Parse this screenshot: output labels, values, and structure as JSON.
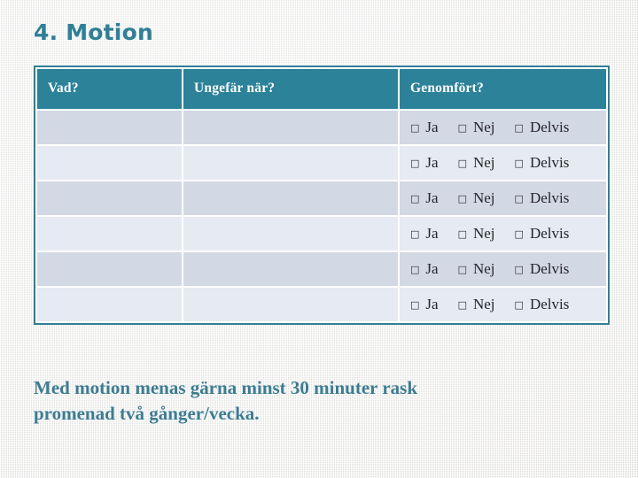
{
  "slide": {
    "title": "4. Motion",
    "footnote_lines": [
      "Med motion menas gärna minst 30 minuter rask",
      "promenad  två gånger/vecka."
    ],
    "footnote": "Med motion menas gärna minst 30 minuter rask promenad  två gånger/vecka."
  },
  "table": {
    "headers": [
      "Vad?",
      "Ungefär när?",
      "Genomfört?"
    ],
    "checkbox_glyph": "□",
    "choice_labels": [
      "Ja",
      "Nej",
      "Delvis"
    ],
    "rows": [
      {
        "what": "",
        "when": "",
        "choices": [
          "Ja",
          "Nej",
          "Delvis"
        ]
      },
      {
        "what": "",
        "when": "",
        "choices": [
          "Ja",
          "Nej",
          "Delvis"
        ]
      },
      {
        "what": "",
        "when": "",
        "choices": [
          "Ja",
          "Nej",
          "Delvis"
        ]
      },
      {
        "what": "",
        "when": "",
        "choices": [
          "Ja",
          "Nej",
          "Delvis"
        ]
      },
      {
        "what": "",
        "when": "",
        "choices": [
          "Ja",
          "Nej",
          "Delvis"
        ]
      },
      {
        "what": "",
        "when": "",
        "choices": [
          "Ja",
          "Nej",
          "Delvis"
        ]
      }
    ]
  },
  "colors": {
    "accent_teal": "#2b8299",
    "title_teal": "#2f7f96",
    "footnote_teal": "#3c7c92",
    "row_dark": "#d2d8e4",
    "row_light": "#e6eaf2",
    "background": "#f0efed",
    "header_text": "#ffffff",
    "cell_text": "#2a2a33"
  }
}
